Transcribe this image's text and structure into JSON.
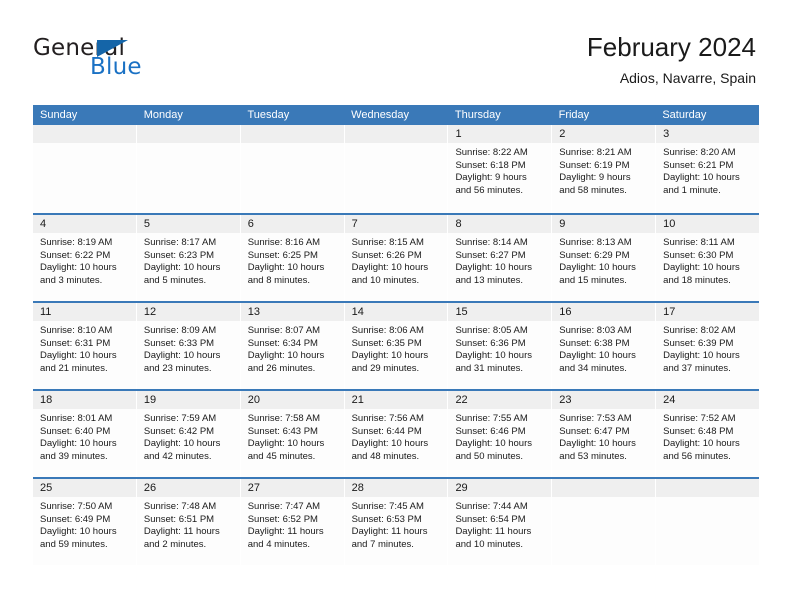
{
  "brand": {
    "name_part1": "General",
    "name_part2": "Blue",
    "flag_icon": "triangle-flag-icon",
    "accent_color": "#1a71c4"
  },
  "header": {
    "title": "February 2024",
    "location": "Adios, Navarre, Spain"
  },
  "calendar": {
    "header_color": "#3a79b8",
    "weekdays": [
      "Sunday",
      "Monday",
      "Tuesday",
      "Wednesday",
      "Thursday",
      "Friday",
      "Saturday"
    ],
    "weeks": [
      [
        {
          "day": "",
          "lines": []
        },
        {
          "day": "",
          "lines": []
        },
        {
          "day": "",
          "lines": []
        },
        {
          "day": "",
          "lines": []
        },
        {
          "day": "1",
          "lines": [
            "Sunrise: 8:22 AM",
            "Sunset: 6:18 PM",
            "Daylight: 9 hours",
            "and 56 minutes."
          ]
        },
        {
          "day": "2",
          "lines": [
            "Sunrise: 8:21 AM",
            "Sunset: 6:19 PM",
            "Daylight: 9 hours",
            "and 58 minutes."
          ]
        },
        {
          "day": "3",
          "lines": [
            "Sunrise: 8:20 AM",
            "Sunset: 6:21 PM",
            "Daylight: 10 hours",
            "and 1 minute."
          ]
        }
      ],
      [
        {
          "day": "4",
          "lines": [
            "Sunrise: 8:19 AM",
            "Sunset: 6:22 PM",
            "Daylight: 10 hours",
            "and 3 minutes."
          ]
        },
        {
          "day": "5",
          "lines": [
            "Sunrise: 8:17 AM",
            "Sunset: 6:23 PM",
            "Daylight: 10 hours",
            "and 5 minutes."
          ]
        },
        {
          "day": "6",
          "lines": [
            "Sunrise: 8:16 AM",
            "Sunset: 6:25 PM",
            "Daylight: 10 hours",
            "and 8 minutes."
          ]
        },
        {
          "day": "7",
          "lines": [
            "Sunrise: 8:15 AM",
            "Sunset: 6:26 PM",
            "Daylight: 10 hours",
            "and 10 minutes."
          ]
        },
        {
          "day": "8",
          "lines": [
            "Sunrise: 8:14 AM",
            "Sunset: 6:27 PM",
            "Daylight: 10 hours",
            "and 13 minutes."
          ]
        },
        {
          "day": "9",
          "lines": [
            "Sunrise: 8:13 AM",
            "Sunset: 6:29 PM",
            "Daylight: 10 hours",
            "and 15 minutes."
          ]
        },
        {
          "day": "10",
          "lines": [
            "Sunrise: 8:11 AM",
            "Sunset: 6:30 PM",
            "Daylight: 10 hours",
            "and 18 minutes."
          ]
        }
      ],
      [
        {
          "day": "11",
          "lines": [
            "Sunrise: 8:10 AM",
            "Sunset: 6:31 PM",
            "Daylight: 10 hours",
            "and 21 minutes."
          ]
        },
        {
          "day": "12",
          "lines": [
            "Sunrise: 8:09 AM",
            "Sunset: 6:33 PM",
            "Daylight: 10 hours",
            "and 23 minutes."
          ]
        },
        {
          "day": "13",
          "lines": [
            "Sunrise: 8:07 AM",
            "Sunset: 6:34 PM",
            "Daylight: 10 hours",
            "and 26 minutes."
          ]
        },
        {
          "day": "14",
          "lines": [
            "Sunrise: 8:06 AM",
            "Sunset: 6:35 PM",
            "Daylight: 10 hours",
            "and 29 minutes."
          ]
        },
        {
          "day": "15",
          "lines": [
            "Sunrise: 8:05 AM",
            "Sunset: 6:36 PM",
            "Daylight: 10 hours",
            "and 31 minutes."
          ]
        },
        {
          "day": "16",
          "lines": [
            "Sunrise: 8:03 AM",
            "Sunset: 6:38 PM",
            "Daylight: 10 hours",
            "and 34 minutes."
          ]
        },
        {
          "day": "17",
          "lines": [
            "Sunrise: 8:02 AM",
            "Sunset: 6:39 PM",
            "Daylight: 10 hours",
            "and 37 minutes."
          ]
        }
      ],
      [
        {
          "day": "18",
          "lines": [
            "Sunrise: 8:01 AM",
            "Sunset: 6:40 PM",
            "Daylight: 10 hours",
            "and 39 minutes."
          ]
        },
        {
          "day": "19",
          "lines": [
            "Sunrise: 7:59 AM",
            "Sunset: 6:42 PM",
            "Daylight: 10 hours",
            "and 42 minutes."
          ]
        },
        {
          "day": "20",
          "lines": [
            "Sunrise: 7:58 AM",
            "Sunset: 6:43 PM",
            "Daylight: 10 hours",
            "and 45 minutes."
          ]
        },
        {
          "day": "21",
          "lines": [
            "Sunrise: 7:56 AM",
            "Sunset: 6:44 PM",
            "Daylight: 10 hours",
            "and 48 minutes."
          ]
        },
        {
          "day": "22",
          "lines": [
            "Sunrise: 7:55 AM",
            "Sunset: 6:46 PM",
            "Daylight: 10 hours",
            "and 50 minutes."
          ]
        },
        {
          "day": "23",
          "lines": [
            "Sunrise: 7:53 AM",
            "Sunset: 6:47 PM",
            "Daylight: 10 hours",
            "and 53 minutes."
          ]
        },
        {
          "day": "24",
          "lines": [
            "Sunrise: 7:52 AM",
            "Sunset: 6:48 PM",
            "Daylight: 10 hours",
            "and 56 minutes."
          ]
        }
      ],
      [
        {
          "day": "25",
          "lines": [
            "Sunrise: 7:50 AM",
            "Sunset: 6:49 PM",
            "Daylight: 10 hours",
            "and 59 minutes."
          ]
        },
        {
          "day": "26",
          "lines": [
            "Sunrise: 7:48 AM",
            "Sunset: 6:51 PM",
            "Daylight: 11 hours",
            "and 2 minutes."
          ]
        },
        {
          "day": "27",
          "lines": [
            "Sunrise: 7:47 AM",
            "Sunset: 6:52 PM",
            "Daylight: 11 hours",
            "and 4 minutes."
          ]
        },
        {
          "day": "28",
          "lines": [
            "Sunrise: 7:45 AM",
            "Sunset: 6:53 PM",
            "Daylight: 11 hours",
            "and 7 minutes."
          ]
        },
        {
          "day": "29",
          "lines": [
            "Sunrise: 7:44 AM",
            "Sunset: 6:54 PM",
            "Daylight: 11 hours",
            "and 10 minutes."
          ]
        },
        {
          "day": "",
          "lines": []
        },
        {
          "day": "",
          "lines": []
        }
      ]
    ]
  }
}
